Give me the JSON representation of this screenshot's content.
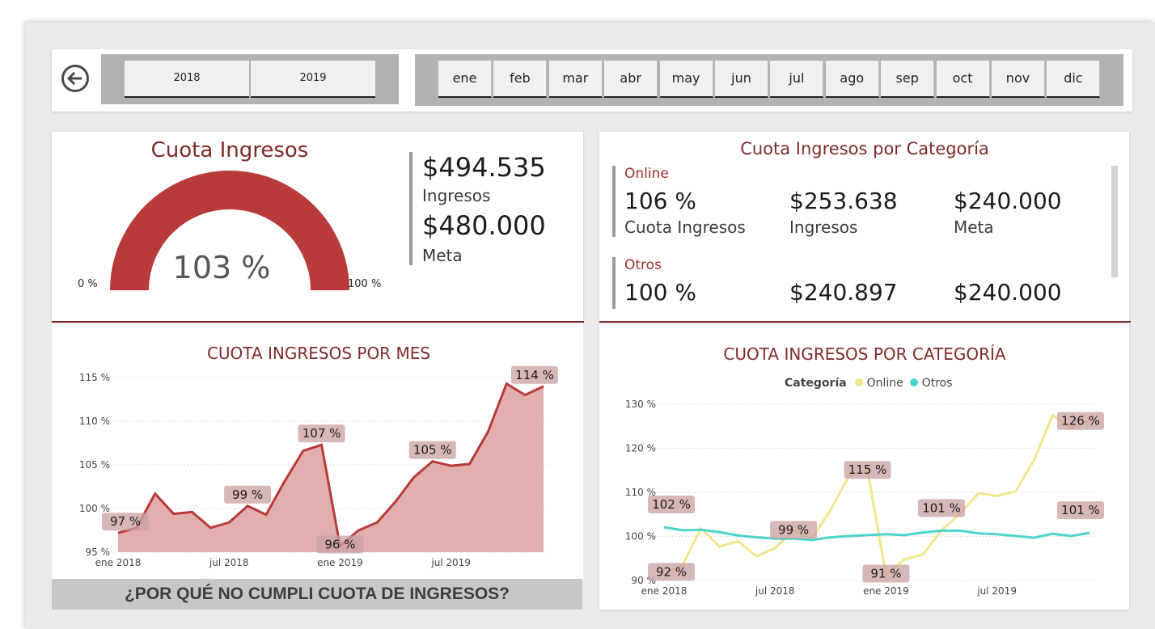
{
  "filters": {
    "years": [
      "2018",
      "2019"
    ],
    "months": [
      "ene",
      "feb",
      "mar",
      "abr",
      "may",
      "jun",
      "jul",
      "ago",
      "sep",
      "oct",
      "nov",
      "dic"
    ]
  },
  "gauge": {
    "title": "Cuota Ingresos",
    "value_label": "103 %",
    "min_label": "0 %",
    "max_label": "100 %",
    "fraction": 1.0,
    "color": "#b83a3a"
  },
  "kpis": {
    "ingresos_value": "$494.535",
    "ingresos_label": "Ingresos",
    "meta_value": "$480.000",
    "meta_label": "Meta"
  },
  "category_cards": {
    "title": "Cuota Ingresos por Categoría",
    "rows": [
      {
        "name": "Online",
        "cuota": "106 %",
        "cuota_label": "Cuota Ingresos",
        "ingresos": "$253.638",
        "ingresos_label": "Ingresos",
        "meta": "$240.000",
        "meta_label": "Meta"
      },
      {
        "name": "Otros",
        "cuota": "100 %",
        "ingresos": "$240.897",
        "meta": "$240.000"
      }
    ]
  },
  "why_button": "¿POR QUÉ NO CUMPLI CUOTA DE INGRESOS?",
  "colors": {
    "accent": "#7f2a2a",
    "area_fill": "#e2aeae",
    "area_line": "#b83a3a",
    "online": "#f0e68c",
    "otros": "#4dd3cd"
  },
  "chart_data": [
    {
      "type": "area",
      "title": "CUOTA INGRESOS POR MES",
      "x": [
        "ene 2018",
        "feb 2018",
        "mar 2018",
        "abr 2018",
        "may 2018",
        "jun 2018",
        "jul 2018",
        "ago 2018",
        "sep 2018",
        "oct 2018",
        "nov 2018",
        "dic 2018",
        "ene 2019",
        "feb 2019",
        "mar 2019",
        "abr 2019",
        "may 2019",
        "jun 2019",
        "jul 2019",
        "ago 2019",
        "sep 2019",
        "oct 2019",
        "nov 2019",
        "dic 2019"
      ],
      "values": [
        97.2,
        97.8,
        101.7,
        99.4,
        99.6,
        97.8,
        98.4,
        100.3,
        99.3,
        103.1,
        106.6,
        107.3,
        95.7,
        97.5,
        98.4,
        100.8,
        103.6,
        105.4,
        104.9,
        105.1,
        108.8,
        114.3,
        113.0,
        114.0
      ],
      "data_labels": [
        {
          "index": 0,
          "text": "97 %"
        },
        {
          "index": 7,
          "text": "99 %"
        },
        {
          "index": 11,
          "text": "107 %"
        },
        {
          "index": 12,
          "text": "96 %"
        },
        {
          "index": 17,
          "text": "105 %"
        },
        {
          "index": 23,
          "text": "114 %"
        }
      ],
      "x_ticks": [
        {
          "index": 0,
          "text": "ene 2018"
        },
        {
          "index": 6,
          "text": "jul 2018"
        },
        {
          "index": 12,
          "text": "ene 2019"
        },
        {
          "index": 18,
          "text": "jul 2019"
        }
      ],
      "y_ticks": [
        "95 %",
        "100 %",
        "105 %",
        "110 %",
        "115 %"
      ],
      "ylim": [
        95,
        115
      ],
      "grid": true
    },
    {
      "type": "line",
      "title": "CUOTA INGRESOS POR CATEGORÍA",
      "legend_title": "Categoría",
      "legend_position": "top",
      "x": [
        "ene 2018",
        "feb 2018",
        "mar 2018",
        "abr 2018",
        "may 2018",
        "jun 2018",
        "jul 2018",
        "ago 2018",
        "sep 2018",
        "oct 2018",
        "nov 2018",
        "dic 2018",
        "ene 2019",
        "feb 2019",
        "mar 2019",
        "abr 2019",
        "may 2019",
        "jun 2019",
        "jul 2019",
        "ago 2019",
        "sep 2019",
        "oct 2019",
        "nov 2019",
        "dic 2019"
      ],
      "series": [
        {
          "name": "Online",
          "values": [
            91.6,
            93.5,
            101.8,
            97.7,
            98.9,
            95.5,
            97.3,
            101.5,
            99.5,
            106.0,
            113.8,
            115.1,
            91.2,
            94.8,
            95.9,
            101.4,
            105.2,
            109.8,
            109.2,
            110.2,
            117.3,
            127.5,
            124.7,
            126.2
          ]
        },
        {
          "name": "Otros",
          "values": [
            102.1,
            101.4,
            101.5,
            101.0,
            100.2,
            99.8,
            99.5,
            99.5,
            99.2,
            99.8,
            100.1,
            100.3,
            100.5,
            100.3,
            100.9,
            101.3,
            101.3,
            100.7,
            100.5,
            100.1,
            99.7,
            100.6,
            100.1,
            100.8
          ]
        }
      ],
      "data_labels": [
        {
          "series": 0,
          "index": 0,
          "text": "92 %"
        },
        {
          "series": 1,
          "index": 0,
          "text": "102 %"
        },
        {
          "series": 0,
          "index": 7,
          "text": "99 %"
        },
        {
          "series": 0,
          "index": 11,
          "text": "115 %"
        },
        {
          "series": 0,
          "index": 12,
          "text": "91 %"
        },
        {
          "series": 1,
          "index": 15,
          "text": "101 %"
        },
        {
          "series": 0,
          "index": 23,
          "text": "126 %"
        },
        {
          "series": 1,
          "index": 23,
          "text": "101 %"
        }
      ],
      "x_ticks": [
        {
          "index": 0,
          "text": "ene 2018"
        },
        {
          "index": 6,
          "text": "jul 2018"
        },
        {
          "index": 12,
          "text": "ene 2019"
        },
        {
          "index": 18,
          "text": "jul 2019"
        }
      ],
      "y_ticks": [
        "90 %",
        "100 %",
        "110 %",
        "120 %",
        "130 %"
      ],
      "ylim": [
        90,
        130
      ],
      "grid": true
    }
  ]
}
